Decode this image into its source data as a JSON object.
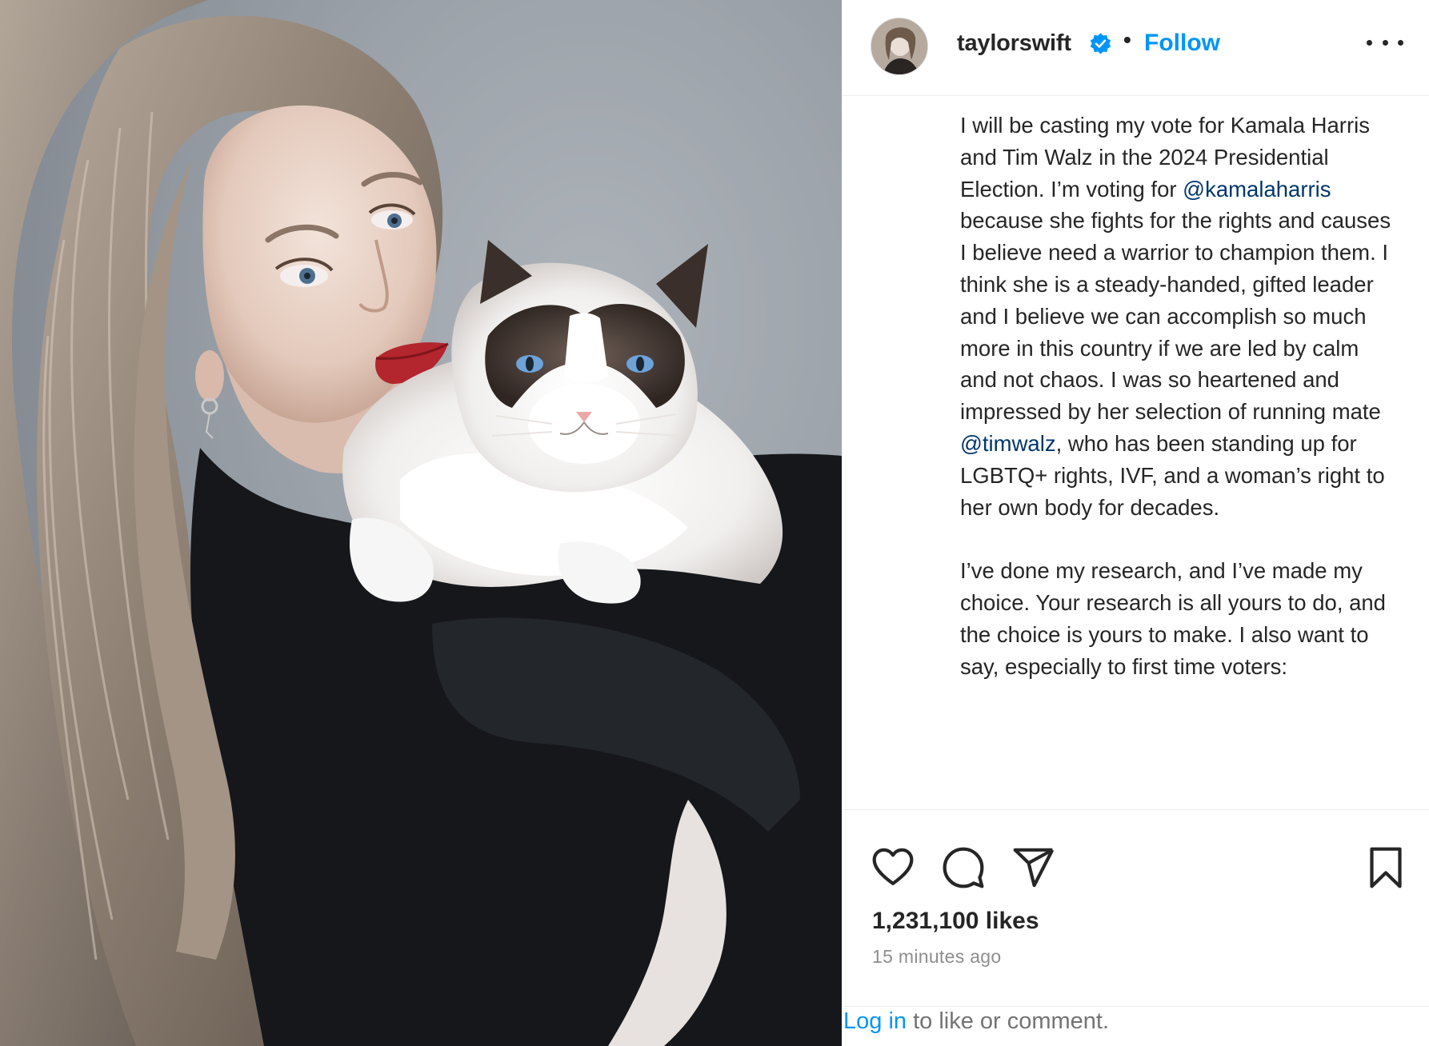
{
  "post": {
    "username": "taylorswift",
    "separator": "•",
    "follow_label": "Follow",
    "caption_paragraphs": [
      [
        {
          "text": "I will be casting my vote for Kamala Harris and Tim Walz in the 2024 Presidential Election. I’m voting for "
        },
        {
          "text": "@kamalaharris",
          "mention": true
        },
        {
          "text": " because she fights for the rights and causes I believe need a warrior to champion them. I think she is a steady-handed, gifted leader and I believe we can accomplish so much more in this country if we are led by calm and not chaos. I was so heartened and impressed by her selection of running mate "
        },
        {
          "text": "@timwalz",
          "mention": true
        },
        {
          "text": ", who has been standing up for LGBTQ+ rights, IVF, and a woman’s right to her own body for decades."
        }
      ],
      [
        {
          "text": "I’ve done my research, and I’ve made my choice. Your research is all yours to do, and the choice is yours to make. I also want to say, especially to first time voters:"
        }
      ]
    ],
    "likes": "1,231,100 likes",
    "time_ago": "15 minutes ago",
    "login_link": "Log in",
    "login_suffix": " to like or comment."
  },
  "icons": {
    "verified": "verified-badge-icon",
    "more": "more-options-icon",
    "like": "heart-icon",
    "comment": "comment-icon",
    "share": "share-icon",
    "save": "bookmark-icon"
  },
  "colors": {
    "link_blue": "#0095f6",
    "mention_blue": "#00376b",
    "text": "#262626",
    "muted": "#8e8e8e"
  }
}
